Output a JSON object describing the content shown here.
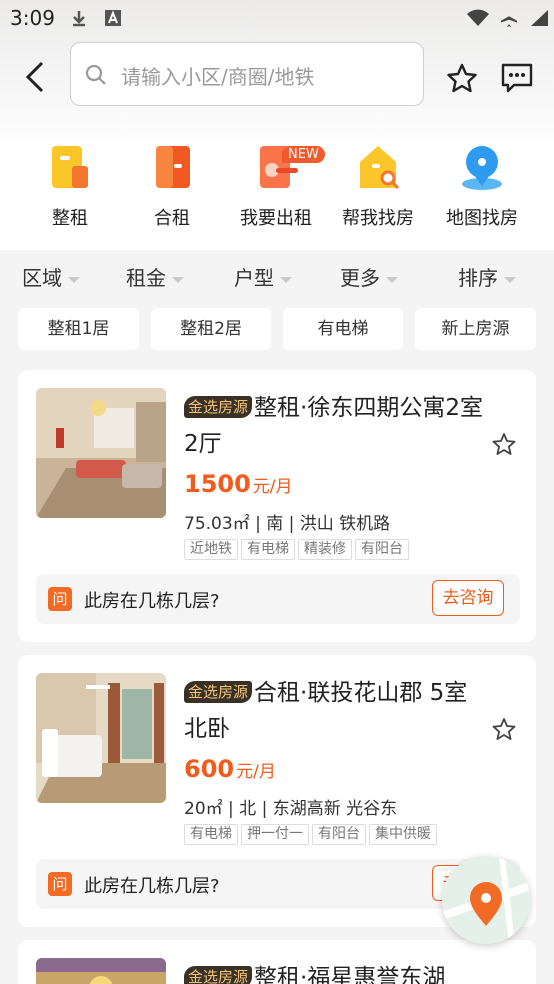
{
  "status_bar": {
    "time": "3:09"
  },
  "search": {
    "placeholder": "请输入小区/商圈/地铁"
  },
  "categories": [
    {
      "label": "整租",
      "icon": "whole-rent-icon"
    },
    {
      "label": "合租",
      "icon": "shared-rent-icon"
    },
    {
      "label": "我要出租",
      "icon": "list-for-rent-icon"
    },
    {
      "label": "帮我找房",
      "icon": "find-home-icon"
    },
    {
      "label": "地图找房",
      "icon": "map-search-icon"
    }
  ],
  "new_badge": "NEW",
  "filters": [
    "区域",
    "租金",
    "户型",
    "更多",
    "排序"
  ],
  "chips": [
    "整租1居",
    "整租2居",
    "有电梯",
    "新上房源"
  ],
  "listings": [
    {
      "badge": "金选房源",
      "title": "整租·徐东四期公寓2室2厅",
      "price": "1500",
      "price_unit": "元/月",
      "info": "75.03㎡ | 南 | 洪山 铁机路",
      "tags": [
        "近地铁",
        "有电梯",
        "精装修",
        "有阳台"
      ],
      "question_icon": "问",
      "question": "此房在几栋几层?",
      "consult": "去咨询"
    },
    {
      "badge": "金选房源",
      "title": "合租·联投花山郡 5室 北卧",
      "price": "600",
      "price_unit": "元/月",
      "info": "20㎡ | 北 | 东湖高新 光谷东",
      "tags": [
        "有电梯",
        "押一付一",
        "有阳台",
        "集中供暖"
      ],
      "question_icon": "问",
      "question": "此房在几栋几层?",
      "consult": "去咨询"
    },
    {
      "badge": "金选房源",
      "title": "整租·福星惠誉东湖"
    }
  ],
  "colors": {
    "accent": "#f15b1c",
    "badge_bg": "#3a3126",
    "badge_text": "#f2c37a"
  }
}
